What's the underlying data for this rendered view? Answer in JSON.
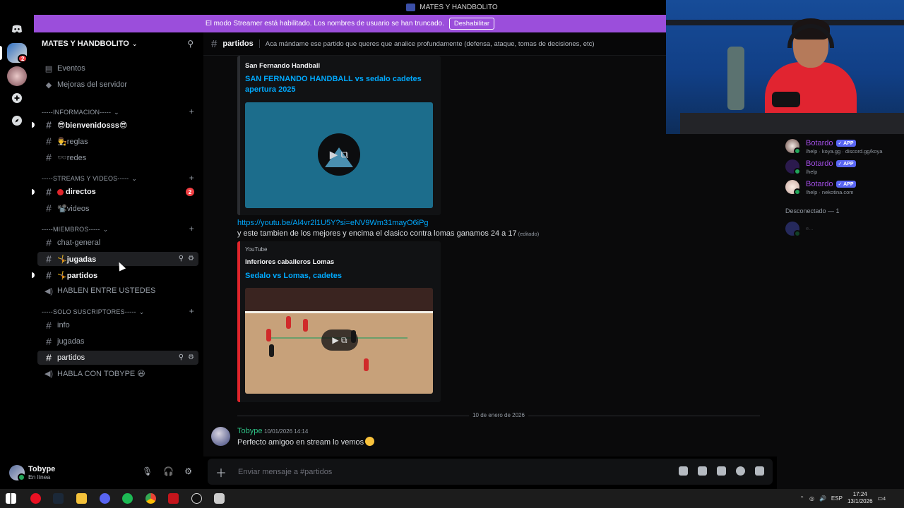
{
  "window": {
    "title": "MATES Y HANDBOLITO"
  },
  "banner": {
    "text": "El modo Streamer está habilitado. Los nombres de usuario se han truncado.",
    "button": "Deshabilitar"
  },
  "rail": {
    "badge": "2"
  },
  "server": {
    "name": "MATES Y HANDBOLITO"
  },
  "sidebar": {
    "top_items": [
      {
        "label": "Eventos"
      },
      {
        "label": "Mejoras del servidor"
      }
    ],
    "categories": [
      {
        "label": "-----INFORMACION-----"
      },
      {
        "label": "-----STREAMS Y VIDEOS-----"
      },
      {
        "label": "-----MIEMBROS-----"
      },
      {
        "label": "-----SOLO SUSCRIPTORES-----"
      }
    ],
    "channels": [
      {
        "label": "😎bienvenidosss😎"
      },
      {
        "label": "👨‍⚖️reglas"
      },
      {
        "label": "🕶️redes"
      },
      {
        "label": "directos",
        "badge": "2"
      },
      {
        "label": "📽️videos"
      },
      {
        "label": "chat-general"
      },
      {
        "label": "🤸jugadas"
      },
      {
        "label": "🤸partidos"
      },
      {
        "label": "HABLEN ENTRE USTEDES"
      },
      {
        "label": "info"
      },
      {
        "label": "jugadas"
      },
      {
        "label": "partidos"
      },
      {
        "label": "HABLA CON TOBYPE 😆"
      }
    ]
  },
  "user": {
    "name": "Tobype",
    "status": "En línea"
  },
  "chat": {
    "channel": "partidos",
    "topic": "Aca mándame ese partido que queres que analice profundamente (defensa, ataque, tomas de decisiones, etc)",
    "embed1": {
      "author": "San Fernando Handball",
      "title": "SAN FERNANDO HANDBALL vs sedalo cadetes apertura 2025"
    },
    "link": "https://youtu.be/Al4vr2l1U5Y?si=eNV9Wm31mayO6iPg",
    "message": "y este tambien de los mejores y encima el clasico contra lomas ganamos 24 a 17",
    "edited": "(editado)",
    "embed2": {
      "provider": "YouTube",
      "author": "Inferiores caballeros Lomas",
      "title": "Sedalo vs Lomas, cadetes"
    },
    "date_divider": "10 de enero de 2026",
    "last_message": {
      "author": "Tobype",
      "time": "10/01/2026 14:14",
      "text": "Perfecto amigoo en stream lo vemos"
    },
    "composer_placeholder": "Enviar mensaje a #partidos"
  },
  "members": {
    "items": [
      {
        "name": "Botardo",
        "tag": "APP",
        "status": "/help · koya.gg · discord.gg/koya"
      },
      {
        "name": "Botardo",
        "tag": "APP",
        "status": "/help"
      },
      {
        "name": "Botardo",
        "tag": "APP",
        "status": "!help · nekotina.com"
      }
    ],
    "offline_header": "Desconectado — 1",
    "offline_name": "e..."
  },
  "taskbar": {
    "lang": "ESP",
    "time": "17:24",
    "date": "13/1/2026",
    "notifications": "4"
  },
  "colors": {
    "accent": "#9b4edb",
    "link": "#00a8fc",
    "online": "#23a55a",
    "bot": "#a34ee6",
    "author": "#2ec286"
  }
}
